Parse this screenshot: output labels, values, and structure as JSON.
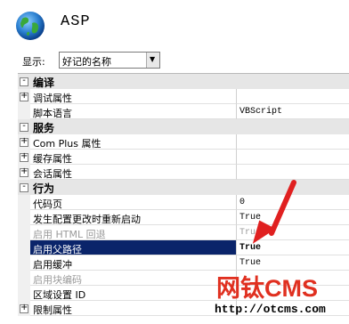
{
  "header": {
    "title": "ASP",
    "icon": "globe-icon"
  },
  "toolbar": {
    "show_label": "显示:",
    "select_value": "好记的名称"
  },
  "grid": {
    "rows": [
      {
        "kind": "cat",
        "toggle": "-",
        "label": "编译"
      },
      {
        "kind": "prop",
        "toggle": "+",
        "label": "调试属性",
        "value": ""
      },
      {
        "kind": "prop",
        "toggle": "",
        "label": "脚本语言",
        "value": "VBScript"
      },
      {
        "kind": "cat",
        "toggle": "-",
        "label": "服务"
      },
      {
        "kind": "prop",
        "toggle": "+",
        "label": "Com Plus 属性",
        "value": ""
      },
      {
        "kind": "prop",
        "toggle": "+",
        "label": "缓存属性",
        "value": ""
      },
      {
        "kind": "prop",
        "toggle": "+",
        "label": "会话属性",
        "value": ""
      },
      {
        "kind": "cat",
        "toggle": "-",
        "label": "行为"
      },
      {
        "kind": "prop",
        "toggle": "",
        "label": "代码页",
        "value": "0"
      },
      {
        "kind": "prop",
        "toggle": "",
        "label": "发生配置更改时重新启动",
        "value": "True"
      },
      {
        "kind": "prop",
        "toggle": "",
        "label": "启用 HTML 回退",
        "value": "True",
        "disabled": true
      },
      {
        "kind": "prop",
        "toggle": "",
        "label": "启用父路径",
        "value": "True",
        "selected": true
      },
      {
        "kind": "prop",
        "toggle": "",
        "label": "启用缓冲",
        "value": "True"
      },
      {
        "kind": "prop",
        "toggle": "",
        "label": "启用块编码",
        "value": "",
        "disabled": true
      },
      {
        "kind": "prop",
        "toggle": "",
        "label": "区域设置 ID",
        "value": ""
      },
      {
        "kind": "prop",
        "toggle": "+",
        "label": "限制属性",
        "value": ""
      }
    ]
  },
  "watermark": {
    "text": "网钛CMS",
    "url": "http://otcms.com"
  },
  "colors": {
    "selection": "#0a246a",
    "arrow": "#e02020",
    "watermark": "#e03020"
  }
}
